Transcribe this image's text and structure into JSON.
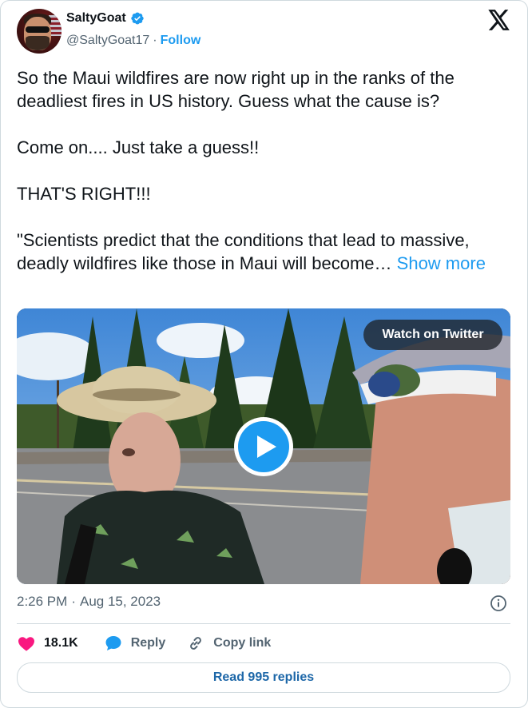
{
  "author": {
    "display_name": "SaltyGoat",
    "handle": "@SaltyGoat17",
    "separator": "·",
    "follow_label": "Follow"
  },
  "tweet": {
    "line1": "So the Maui wildfires are now right up in the ranks of the deadliest fires in US history.  Guess what the cause is?",
    "line2": "Come on....   Just take a guess!!",
    "line3": "THAT'S RIGHT!!!",
    "line4": "\"Scientists predict that the conditions that lead to massive, deadly wildfires like those in Maui will become… ",
    "show_more": "Show more"
  },
  "media": {
    "watch_label": "Watch on Twitter"
  },
  "meta": {
    "time": "2:26 PM",
    "separator": "·",
    "date": "Aug 15, 2023"
  },
  "actions": {
    "likes_count": "18.1K",
    "reply_label": "Reply",
    "copy_label": "Copy link"
  },
  "replies_button": "Read 995 replies",
  "colors": {
    "accent": "#1d9bf0",
    "like": "#f91880",
    "reply_icon": "#1d9bf0"
  }
}
